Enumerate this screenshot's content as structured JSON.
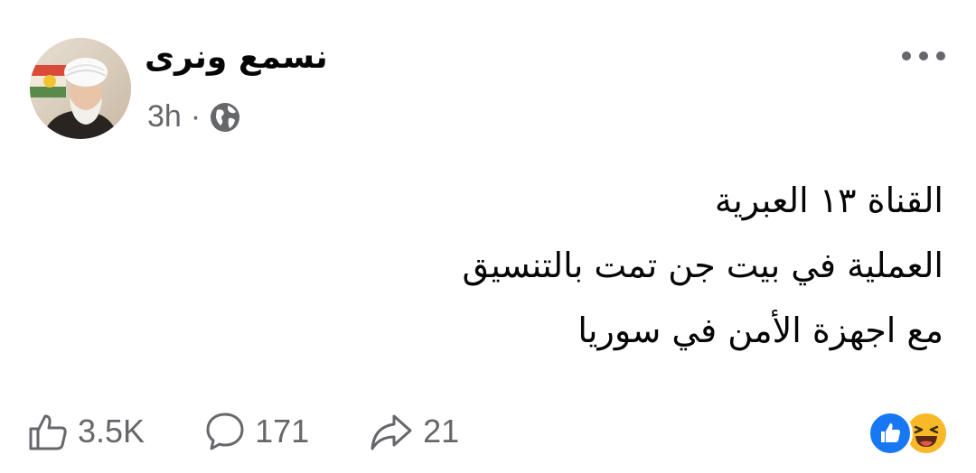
{
  "post": {
    "author": "نسمع ونرى",
    "time": "3h",
    "separator": "·",
    "privacy_icon": "globe-icon",
    "menu_icon": "more-dots-icon",
    "text_lines": [
      "القناة ١٣ العبرية",
      "العملية في بيت جن تمت بالتنسيق",
      "مع اجهزة الأمن في سوريا"
    ]
  },
  "footer": {
    "likes": "3.5K",
    "comments": "171",
    "shares": "21",
    "like_icon": "thumbs-up-icon",
    "comment_icon": "comment-bubble-icon",
    "share_icon": "share-arrow-icon",
    "reactions": [
      "like-reaction-icon",
      "haha-reaction-icon"
    ]
  },
  "colors": {
    "text": "#050505",
    "secondary": "#65676b",
    "like_blue": "#1877f2",
    "haha_yellow": "#f7b928"
  }
}
